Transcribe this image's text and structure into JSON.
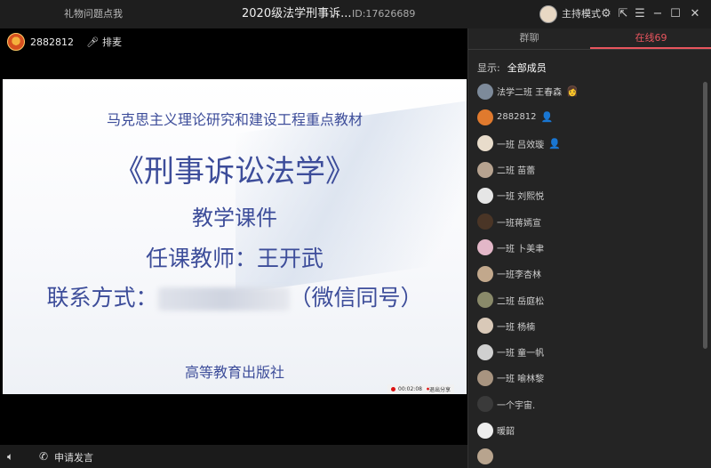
{
  "titlebar": {
    "left_link": "礼物问题点我",
    "title": "2020级法学刑事诉...",
    "room_id": "ID:17626689",
    "mode": "主持模式",
    "icons": [
      "settings-icon",
      "popout-icon",
      "menu-icon",
      "minimize-icon",
      "maximize-icon",
      "close-icon"
    ]
  },
  "host": {
    "name": "2882812",
    "mic_label": "排麦"
  },
  "slide": {
    "line1": "马克思主义理论研究和建设工程重点教材",
    "line2": "《刑事诉讼法学》",
    "line3": "教学课件",
    "line4": "任课教师：王开武",
    "contact_label": "联系方式：",
    "contact_suffix": "（微信同号）",
    "publisher": "高等教育出版社"
  },
  "recording": {
    "time": "00:02:08",
    "exit_label": "退出分享"
  },
  "bottombar": {
    "apply_label": "申请发言"
  },
  "panel": {
    "tabs": [
      {
        "label": "群聊"
      },
      {
        "label": "在线69"
      }
    ],
    "filter_label": "显示:",
    "filter_value": "全部成员",
    "members": [
      {
        "name": "法学二班 王春森",
        "avatar_color": "#7d8a9a",
        "badge": "👩"
      },
      {
        "name": "2882812",
        "avatar_color": "#e07a2e",
        "badge": "👤"
      },
      {
        "name": "一班  吕效璇",
        "avatar_color": "#e8dccb",
        "badge": "👤"
      },
      {
        "name": "二班 苗蕾",
        "avatar_color": "#b7a390",
        "badge": ""
      },
      {
        "name": "一班 刘熙悦",
        "avatar_color": "#e6e6e6",
        "badge": ""
      },
      {
        "name": "一班蒋嫣宣",
        "avatar_color": "#4a3526",
        "badge": ""
      },
      {
        "name": "一班 卜美聿",
        "avatar_color": "#e3b7c8",
        "badge": ""
      },
      {
        "name": "一班李杏林",
        "avatar_color": "#c2a88c",
        "badge": ""
      },
      {
        "name": "二班 岳庭松",
        "avatar_color": "#8a8a6a",
        "badge": ""
      },
      {
        "name": "一班 杨楠",
        "avatar_color": "#d9c9b8",
        "badge": ""
      },
      {
        "name": "一班 童一帆",
        "avatar_color": "#d0d0d0",
        "badge": ""
      },
      {
        "name": "一班 喻林黎",
        "avatar_color": "#a89480",
        "badge": ""
      },
      {
        "name": "一个宇宙.",
        "avatar_color": "#3a3a3a",
        "badge": ""
      },
      {
        "name": "暖韶",
        "avatar_color": "#eeeeee",
        "badge": ""
      },
      {
        "name": "",
        "avatar_color": "#b8a48e",
        "badge": ""
      }
    ]
  },
  "colors": {
    "accent": "#e8555e",
    "slide_text": "#3d4d9a",
    "panel_bg": "#242424"
  }
}
